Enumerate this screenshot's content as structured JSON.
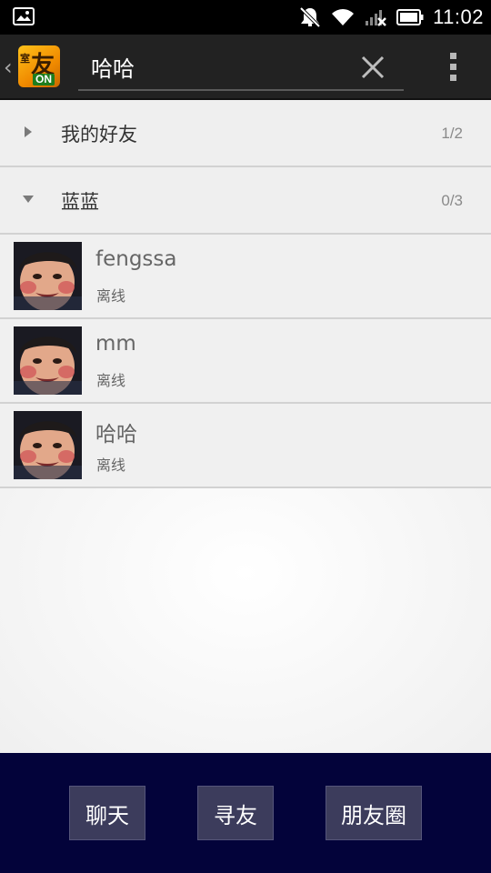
{
  "status_bar": {
    "time": "11:02",
    "icons": [
      "image-icon",
      "mute-icon",
      "wifi-icon",
      "signal-icon",
      "battery-icon"
    ]
  },
  "action_bar": {
    "back_icon": "chevron-left-icon",
    "logo_text_main": "友",
    "logo_text_small": "室",
    "logo_text_badge": "ON",
    "search_value": "哈哈",
    "clear_icon": "close-icon",
    "menu_icon": "overflow-menu-icon"
  },
  "groups": [
    {
      "name": "我的好友",
      "count": "1/2",
      "expanded": false
    },
    {
      "name": "蓝蓝",
      "count": "0/3",
      "expanded": true
    }
  ],
  "friends": [
    {
      "name": "fengssa",
      "status": "离线"
    },
    {
      "name": "mm",
      "status": "离线"
    },
    {
      "name": "哈哈",
      "status": "离线"
    }
  ],
  "bottom_tabs": [
    {
      "label": "聊天"
    },
    {
      "label": "寻友"
    },
    {
      "label": "朋友圈"
    }
  ],
  "colors": {
    "action_bar_bg": "#222222",
    "bottom_bar_bg": "#03033a",
    "tab_button_bg": "#3c3c5c",
    "list_bg": "#efefef"
  }
}
